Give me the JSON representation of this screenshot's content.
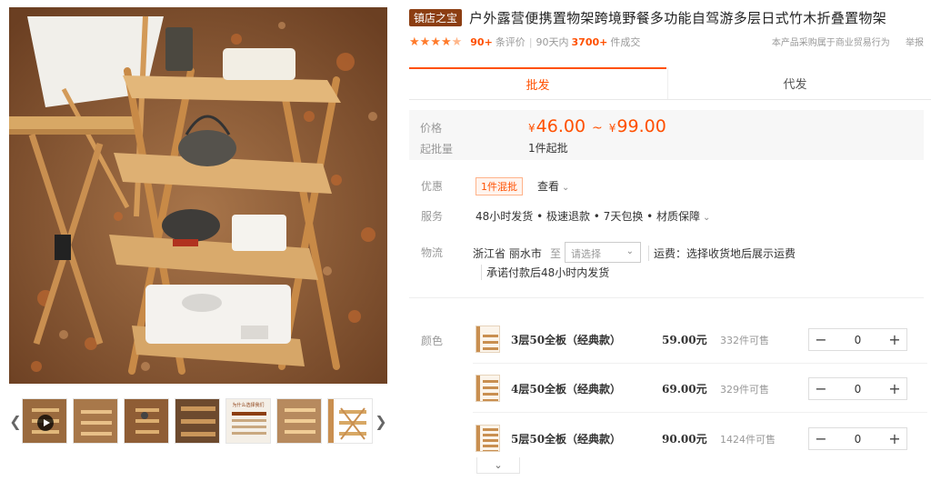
{
  "gallery": {
    "main_image_alt": "main-product-photo",
    "thumbnails": [
      "video",
      "product",
      "product",
      "product",
      "features",
      "product",
      "product"
    ],
    "thumb_feature_text": "为什么选择我们",
    "prev_icon": "chevron-left-icon",
    "next_icon": "chevron-right-icon"
  },
  "product": {
    "shop_badge": "镇店之宝",
    "title": "户外露营便携置物架跨境野餐多功能自驾游多层日式竹木折叠置物架",
    "rating_stars": 4.5,
    "review_count": "90+",
    "review_label": "条评价",
    "sales_period": "90天内",
    "sales_count": "3700+",
    "sales_label": "件成交",
    "b2b_notice": "本产品采购属于商业贸易行为",
    "report_label": "举报"
  },
  "tabs": [
    {
      "label": "批发",
      "active": true
    },
    {
      "label": "代发",
      "active": false
    }
  ],
  "pricing": {
    "price_label": "价格",
    "currency": "¥",
    "price_min": "46.00",
    "range_sep": "~",
    "price_max": "99.00",
    "moq_label": "起批量",
    "moq_value": "1件起批"
  },
  "promo": {
    "label": "优惠",
    "tag": "1件混批",
    "view": "查看"
  },
  "service": {
    "label": "服务",
    "text": "48小时发货 • 极速退款 • 7天包换 • 材质保障"
  },
  "logistics": {
    "label": "物流",
    "origin": "浙江省 丽水市",
    "to": "至",
    "select_placeholder": "请选择",
    "freight": "运费：选择收货地后展示运费",
    "promise": "承诺付款后48小时内发货"
  },
  "sku": {
    "label": "颜色",
    "items": [
      {
        "name": "3层50全板（经典款）",
        "price": "59.00元",
        "stock": "332件可售",
        "qty": "0"
      },
      {
        "name": "4层50全板（经典款）",
        "price": "69.00元",
        "stock": "329件可售",
        "qty": "0"
      },
      {
        "name": "5层50全板（经典款）",
        "price": "90.00元",
        "stock": "1424件可售",
        "qty": "0"
      }
    ],
    "minus": "−",
    "plus": "+"
  },
  "colors": {
    "accent": "#ff5000",
    "badge": "#8c3e12",
    "star": "#ff7b2c"
  }
}
